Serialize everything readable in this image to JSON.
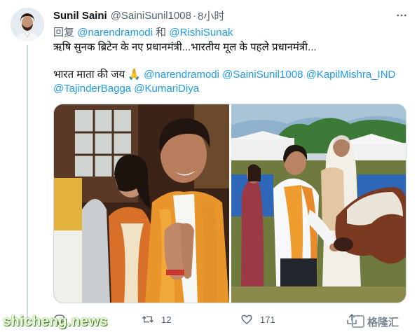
{
  "tweet": {
    "author_name": "Sunil Saini",
    "author_handle": "@SainiSunil1008",
    "separator": "·",
    "time": "8小时",
    "reply_prefix": "回复",
    "reply_mention_1": "@narendramodi",
    "reply_and": "和",
    "reply_mention_2": "@RishiSunak",
    "line1": "ऋषि सुनक ब्रिटेन के नए प्रधानमंत्री...भारतीय मूल के पहले प्रधानमंत्री...",
    "line2_text": "भारत माता की जय 🙏",
    "line2_mentions": "@narendramodi @SainiSunil1008 @KapilMishra_IND",
    "line3_mentions": "@TajinderBagga @KumariDiya",
    "actions": {
      "reply_count": "",
      "retweet_count": "12",
      "like_count": "171"
    },
    "icons": {
      "more": "more-icon",
      "reply": "reply-icon",
      "retweet": "retweet-icon",
      "like": "like-icon",
      "share": "share-icon"
    },
    "colors": {
      "link": "#1d9bf0",
      "secondary": "#536471",
      "text": "#0f1419"
    }
  },
  "watermark": {
    "left": "shicheng.news",
    "right": "格隆汇"
  }
}
